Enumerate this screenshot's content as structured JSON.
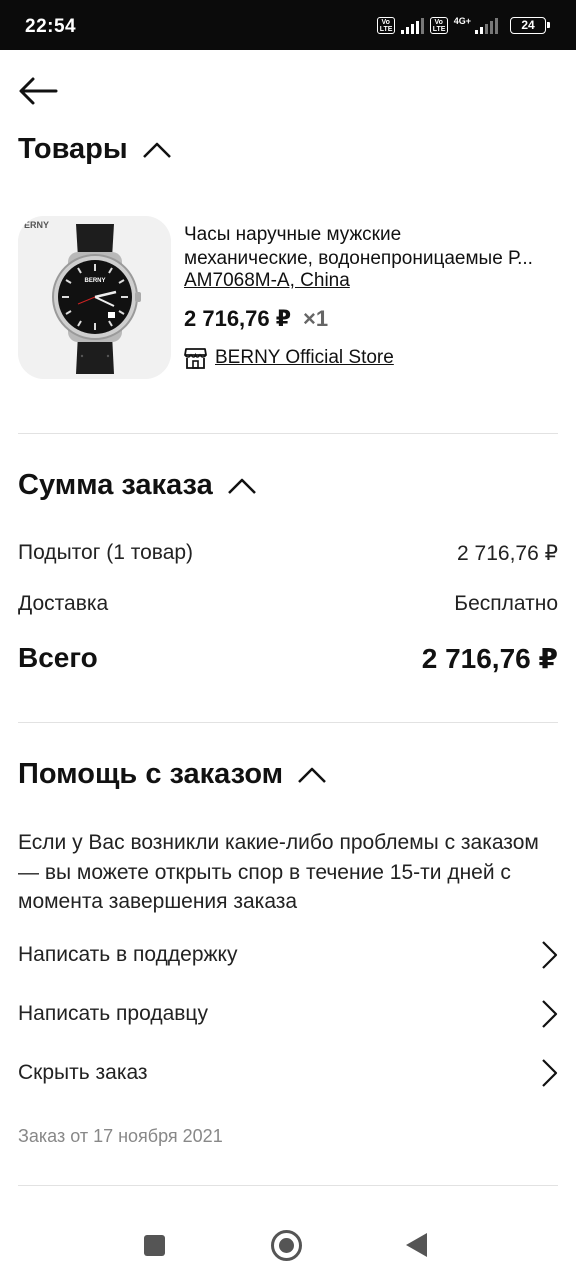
{
  "status_bar": {
    "time": "22:54",
    "volte1": "Vo LTE",
    "volte2": "Vo LTE",
    "network": "4G+",
    "battery": "24"
  },
  "header": {
    "back_icon": "arrow-left-icon"
  },
  "goods": {
    "title": "Товары",
    "item": {
      "image_brand": "BERNY",
      "image_corner": "ERNY",
      "title_line1": "Часы наручные мужские",
      "title_line2": "механические, водонепроницаемые Р...",
      "sku": "AM7068M-A, China",
      "price": "2 716,76 ₽",
      "quantity": "×1",
      "store": "BERNY Official Store"
    }
  },
  "summary": {
    "title": "Сумма заказа",
    "subtotal_label": "Подытог (1 товар)",
    "subtotal_value": "2 716,76 ₽",
    "delivery_label": "Доставка",
    "delivery_value": "Бесплатно",
    "total_label": "Всего",
    "total_value": "2 716,76 ₽"
  },
  "help": {
    "title": "Помощь с заказом",
    "text": "Если у Вас возникли какие-либо проблемы с заказом — вы можете открыть спор в течение 15-ти дней с момента завершения заказа",
    "actions": [
      "Написать в поддержку",
      "Написать продавцу",
      "Скрыть заказ"
    ]
  },
  "order_date": "Заказ от 17 ноября 2021",
  "colors": {
    "text": "#111111",
    "muted": "#888888",
    "divider": "#e2e2e2",
    "status_bar": "#0b0b0b"
  }
}
